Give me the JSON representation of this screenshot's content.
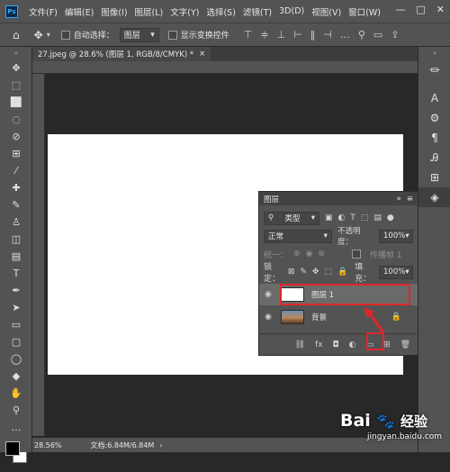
{
  "app": {
    "logo": "Ps"
  },
  "menu": [
    "文件(F)",
    "编辑(E)",
    "图像(I)",
    "图层(L)",
    "文字(Y)",
    "选择(S)",
    "滤镜(T)",
    "3D(D)",
    "视图(V)",
    "窗口(W)"
  ],
  "window_buttons": {
    "minimize": "—",
    "maximize": "□",
    "close": "✕"
  },
  "options": {
    "auto_select_label": "自动选择：",
    "auto_select_value": "图层",
    "show_transform_label": "显示变换控件"
  },
  "document": {
    "tab_title": "27.jpeg @ 28.6% (图层 1, RGB/8/CMYK) *",
    "close": "×"
  },
  "status": {
    "zoom": "28.56%",
    "doc_info": "文档:6.84M/6.84M",
    "arrow": "›"
  },
  "layers_panel": {
    "title": "图层",
    "filter_label": "类型",
    "blend_mode": "正常",
    "opacity_label": "不透明度：",
    "opacity_value": "100%",
    "unify_label": "统一：",
    "propagate_label": "传播帧 1",
    "lock_label": "锁定：",
    "fill_label": "填充：",
    "fill_value": "100%",
    "layers": [
      {
        "name": "图层 1",
        "selected": true,
        "thumb": "white"
      },
      {
        "name": "背景",
        "selected": false,
        "thumb": "photo",
        "locked": true
      }
    ]
  },
  "colors": {
    "accent_red": "#e0262a",
    "panel": "#535353",
    "canvas": "#ffffff"
  },
  "watermark": {
    "main": "Bai",
    "sub": "jingyan.baidu.com",
    "suffix": "经验"
  }
}
